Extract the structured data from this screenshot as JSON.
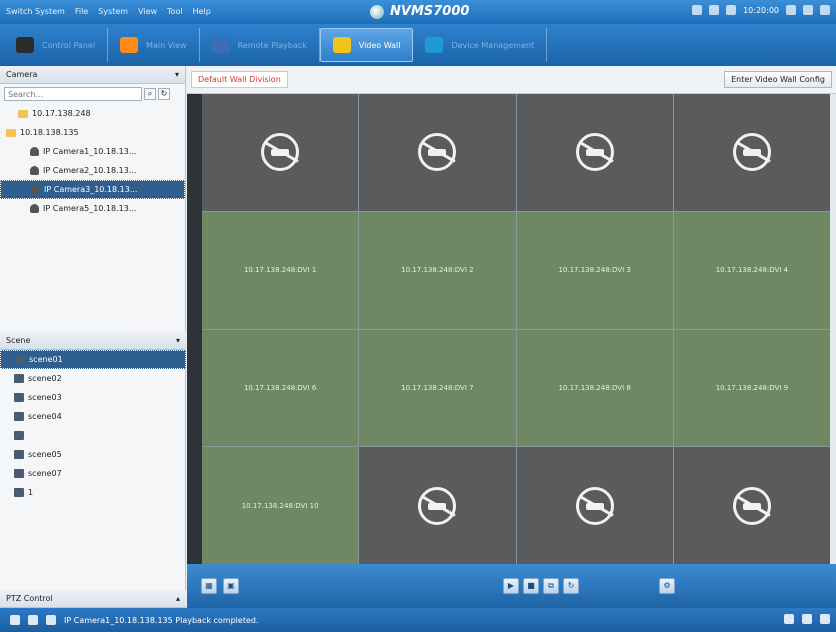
{
  "titlebar": {
    "menu": [
      "Switch System",
      "File",
      "System",
      "View",
      "Tool",
      "Help"
    ],
    "app_name": "NVMS7000",
    "time": "10:20:00"
  },
  "tabs": [
    {
      "label": "Control Panel",
      "icon": "control-panel-icon",
      "color": "#2b2b2b",
      "active": false
    },
    {
      "label": "Main View",
      "icon": "main-view-icon",
      "color": "#ff8c1a",
      "active": false
    },
    {
      "label": "Remote Playback",
      "icon": "remote-playback-icon",
      "color": "#3a6fb8",
      "active": false
    },
    {
      "label": "Video Wall",
      "icon": "video-wall-icon",
      "color": "#f0c419",
      "active": true
    },
    {
      "label": "Device Management",
      "icon": "device-management-icon",
      "color": "#1d9ad6",
      "active": false
    }
  ],
  "camera_panel": {
    "title": "Camera",
    "search_placeholder": "Search...",
    "items": [
      {
        "label": "10.17.138.248",
        "type": "folder",
        "indent": 1
      },
      {
        "label": "10.18.138.135",
        "type": "folder",
        "indent": 0
      },
      {
        "label": "IP Camera1_10.18.13...",
        "type": "camera",
        "indent": 2
      },
      {
        "label": "IP Camera2_10.18.13...",
        "type": "camera",
        "indent": 2
      },
      {
        "label": "IP Camera3_10.18.13...",
        "type": "camera",
        "indent": 2,
        "selected": true
      },
      {
        "label": "IP Camera5_10.18.13...",
        "type": "camera",
        "indent": 2
      }
    ]
  },
  "scene_panel": {
    "title": "Scene",
    "items": [
      {
        "label": "scene01",
        "selected": true
      },
      {
        "label": "scene02"
      },
      {
        "label": "scene03"
      },
      {
        "label": "scene04"
      },
      {
        "label": ""
      },
      {
        "label": "scene05"
      },
      {
        "label": "scene07"
      },
      {
        "label": "1"
      }
    ]
  },
  "ptz_panel": {
    "title": "PTZ Control"
  },
  "wall": {
    "tab_label": "Default Wall Division",
    "config_button": "Enter Video Wall Config",
    "cells": [
      {
        "type": "empty"
      },
      {
        "type": "empty"
      },
      {
        "type": "empty"
      },
      {
        "type": "empty"
      },
      {
        "type": "output",
        "label": "10.17.138.248:DVI 1"
      },
      {
        "type": "output",
        "label": "10.17.138.248:DVI 2"
      },
      {
        "type": "output",
        "label": "10.17.138.248:DVI 3"
      },
      {
        "type": "output",
        "label": "10.17.138.248:DVI 4"
      },
      {
        "type": "output",
        "label": "10.17.138.248:DVI 6"
      },
      {
        "type": "output",
        "label": "10.17.138.248:DVI 7"
      },
      {
        "type": "output",
        "label": "10.17.138.248:DVI 8"
      },
      {
        "type": "output",
        "label": "10.17.138.248:DVI 9"
      },
      {
        "type": "output",
        "label": "10.17.138.248:DVI 10"
      },
      {
        "type": "empty"
      },
      {
        "type": "empty"
      },
      {
        "type": "empty"
      }
    ]
  },
  "status": {
    "message": "IP Camera1_10.18.138.135 Playback completed."
  }
}
